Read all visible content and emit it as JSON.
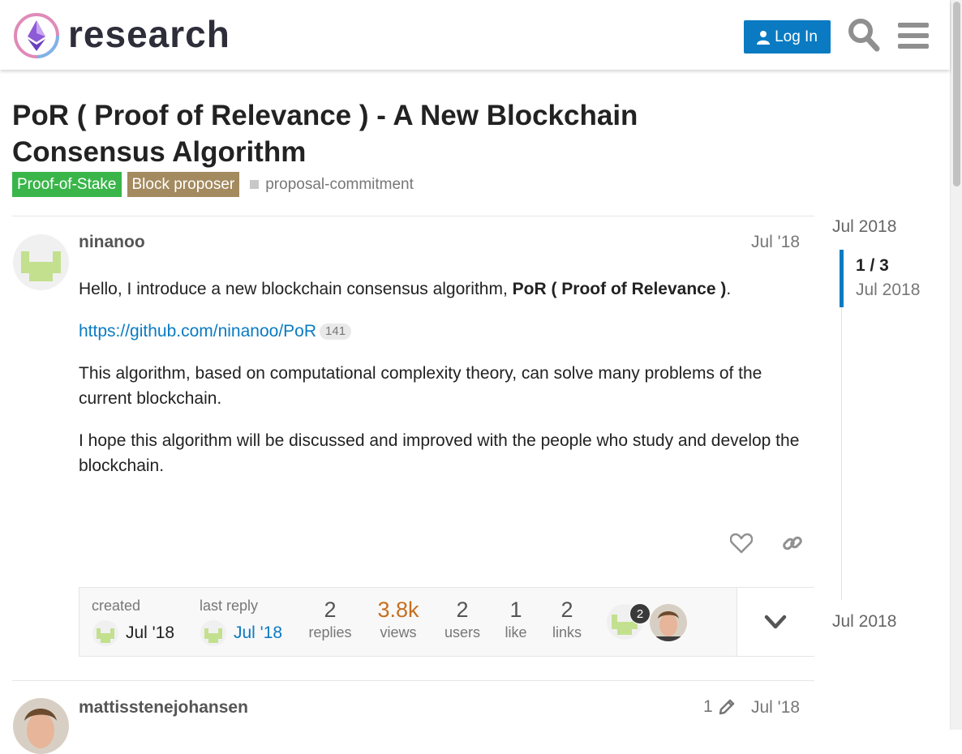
{
  "header": {
    "brand": "research",
    "login_label": "Log In"
  },
  "topic": {
    "title": "PoR ( Proof of Relevance ) - A New Blockchain Consensus Algorithm",
    "categories": [
      {
        "label": "Proof-of-Stake",
        "color": "#3ab54a"
      },
      {
        "label": "Block proposer",
        "color": "#a38a5f"
      }
    ],
    "tags": [
      "proposal-commitment"
    ]
  },
  "post1": {
    "username": "ninanoo",
    "date": "Jul '18",
    "p1_pre": "Hello, I introduce a new blockchain consensus algorithm, ",
    "p1_bold": "PoR ( Proof of Relevance )",
    "p1_post": ".",
    "link_text": "https://github.com/ninanoo/PoR",
    "link_clicks": "141",
    "p3": "This algorithm, based on computational complexity theory, can solve many problems of the current blockchain.",
    "p4": "I hope this algorithm will be discussed and improved with the people who study and develop the blockchain."
  },
  "topic_map": {
    "created_label": "created",
    "created_date": "Jul '18",
    "last_reply_label": "last reply",
    "last_reply_date": "Jul '18",
    "stats": [
      {
        "num": "2",
        "label": "replies"
      },
      {
        "num": "3.8k",
        "label": "views"
      },
      {
        "num": "2",
        "label": "users"
      },
      {
        "num": "1",
        "label": "like"
      },
      {
        "num": "2",
        "label": "links"
      }
    ],
    "participant_badge": "2"
  },
  "timeline": {
    "top_date": "Jul 2018",
    "position": "1 / 3",
    "current_date": "Jul 2018",
    "bottom_date": "Jul 2018"
  },
  "post2": {
    "username": "mattisstenejohansen",
    "edit_count": "1",
    "date": "Jul '18"
  },
  "colors": {
    "accent": "#0a7bc2",
    "views_hot": "#c66f1f",
    "avatar_green": "#c3e08f"
  }
}
